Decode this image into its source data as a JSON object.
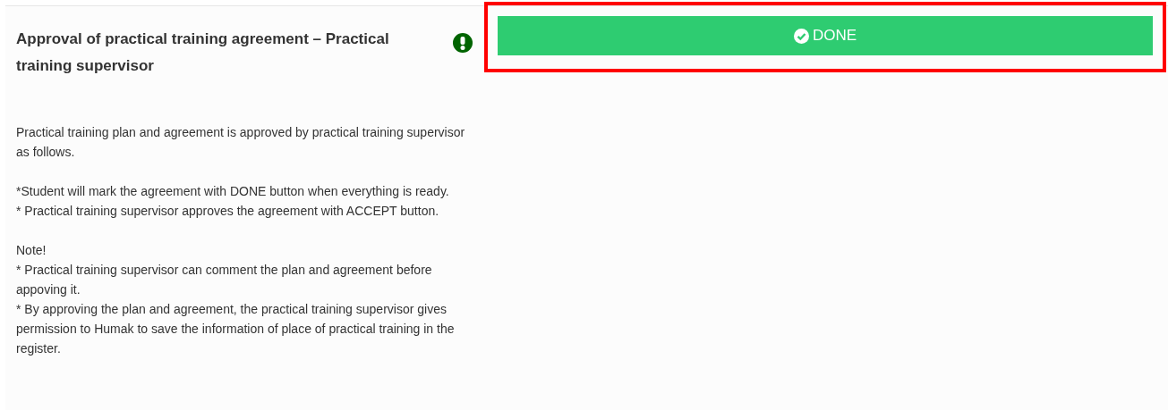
{
  "title": "Approval of practical training agreement – Practical training supervisor",
  "description": [
    [
      "Practical training plan and agreement is approved by practical training supervisor as follows."
    ],
    [
      "*Student will mark the agreement with DONE button when everything is ready.",
      "* Practical training supervisor approves the agreement with ACCEPT button."
    ],
    [
      "Note!",
      "* Practical training supervisor can comment the plan and agreement before appoving it.",
      "* By approving the plan and agreement, the practical training supervisor gives permission to Humak to save the information of place of practical training in the register."
    ]
  ],
  "done_button": {
    "label": "DONE",
    "highlighted": true
  }
}
